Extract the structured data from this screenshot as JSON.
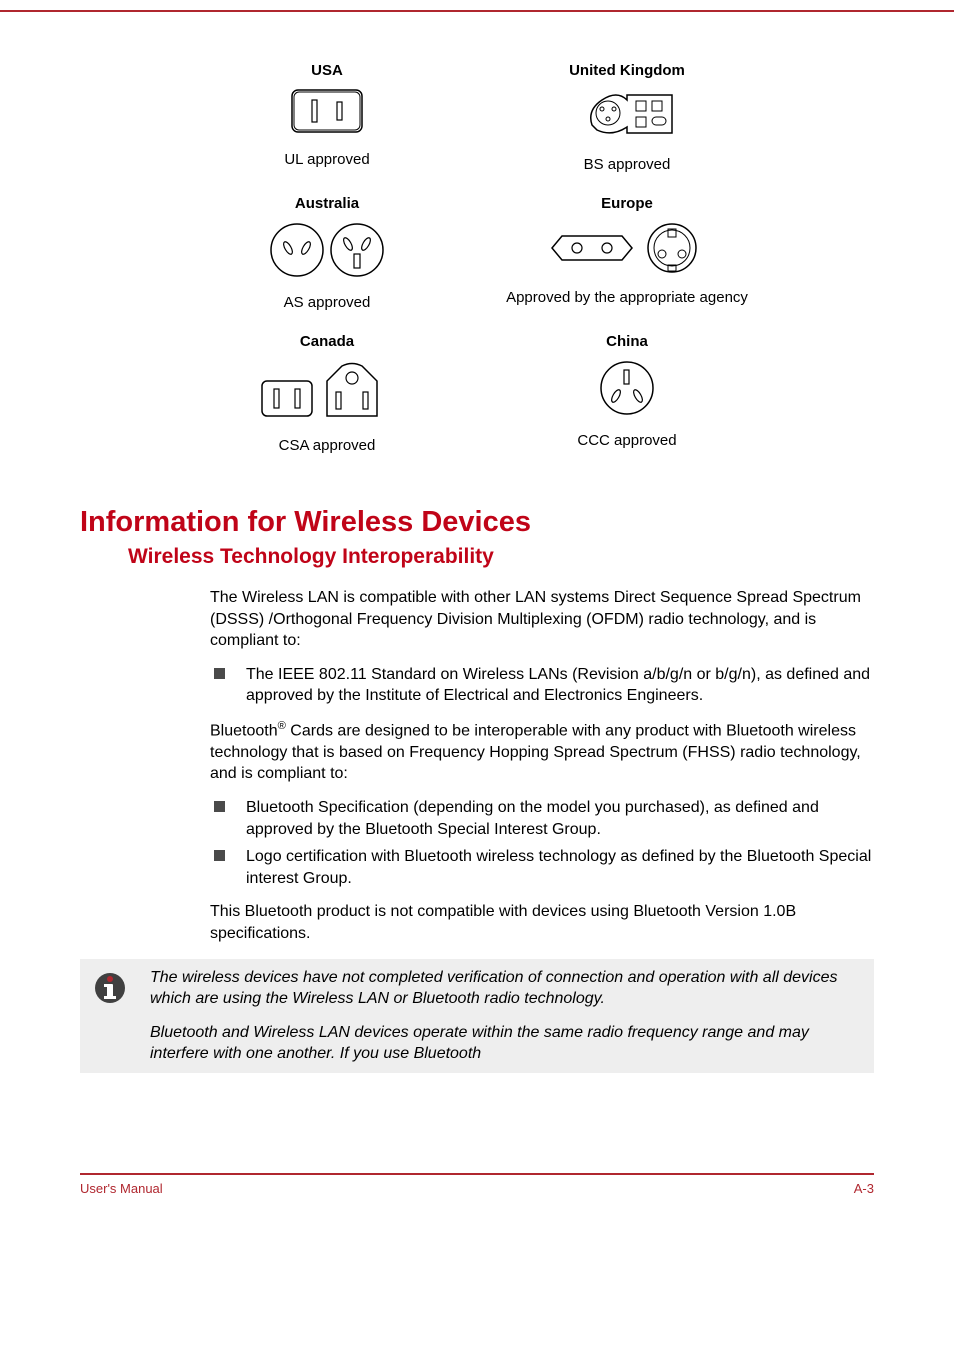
{
  "plugs": [
    {
      "country": "USA",
      "caption": "UL approved"
    },
    {
      "country": "United Kingdom",
      "caption": "BS approved"
    },
    {
      "country": "Australia",
      "caption": "AS approved"
    },
    {
      "country": "Europe",
      "caption": "Approved by the appropriate agency"
    },
    {
      "country": "Canada",
      "caption": "CSA approved"
    },
    {
      "country": "China",
      "caption": "CCC approved"
    }
  ],
  "h1": "Information for Wireless Devices",
  "h2": "Wireless Technology Interoperability",
  "p1": "The Wireless LAN is compatible with other LAN systems Direct Sequence Spread Spectrum (DSSS) /Orthogonal Frequency Division Multiplexing (OFDM) radio technology, and is compliant to:",
  "list1": {
    "item1": "The IEEE 802.11 Standard on Wireless LANs (Revision a/b/g/n or b/g/n), as defined and approved by the Institute of Electrical and Electronics Engineers."
  },
  "p2_pre": "Bluetooth",
  "p2_sup": "®",
  "p2_post": " Cards are designed to be interoperable with any product with Bluetooth wireless technology that is based on Frequency Hopping Spread Spectrum (FHSS) radio technology, and is compliant to:",
  "list2": {
    "item1": "Bluetooth Specification (depending on the model you purchased), as defined and approved by the Bluetooth Special Interest Group.",
    "item2": "Logo certification with Bluetooth wireless technology as defined by the Bluetooth Special interest Group."
  },
  "p3": "This Bluetooth product is not compatible with devices using Bluetooth Version 1.0B specifications.",
  "note1": "The wireless devices have not completed verification of connection and operation with all devices which are using the Wireless LAN or Bluetooth radio technology.",
  "note2": "Bluetooth and Wireless LAN devices operate within the same radio frequency range and may interfere with one another. If you use Bluetooth",
  "footer_left": "User's Manual",
  "footer_right": "A-3"
}
